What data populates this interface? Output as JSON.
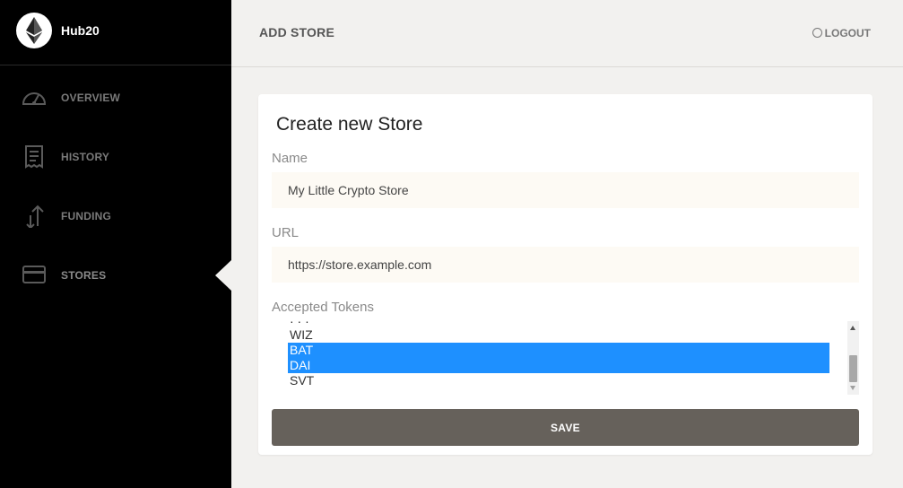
{
  "app": {
    "name": "Hub20",
    "logo_icon": "ethereum-logo-icon"
  },
  "sidebar": {
    "items": [
      {
        "label": "OVERVIEW",
        "icon": "speedometer-icon",
        "active": false
      },
      {
        "label": "HISTORY",
        "icon": "receipt-icon",
        "active": false
      },
      {
        "label": "FUNDING",
        "icon": "transfer-arrows-icon",
        "active": false
      },
      {
        "label": "STORES",
        "icon": "credit-card-icon",
        "active": true
      }
    ]
  },
  "header": {
    "title": "ADD STORE",
    "logout_label": "LOGOUT",
    "logout_icon": "power-icon"
  },
  "form": {
    "title": "Create new Store",
    "name_label": "Name",
    "name_value": "My Little Crypto Store",
    "url_label": "URL",
    "url_value": "https://store.example.com",
    "tokens_label": "Accepted Tokens",
    "tokens": [
      {
        "label": "WIZ",
        "selected": false
      },
      {
        "label": "BAT",
        "selected": true
      },
      {
        "label": "DAI",
        "selected": true
      },
      {
        "label": "SVT",
        "selected": false
      }
    ],
    "save_label": "SAVE"
  },
  "colors": {
    "sidebar_bg": "#000000",
    "page_bg": "#f2f1ef",
    "selected_option": "#1e90ff",
    "save_button": "#66615b",
    "input_bg": "#fdfaf4"
  }
}
